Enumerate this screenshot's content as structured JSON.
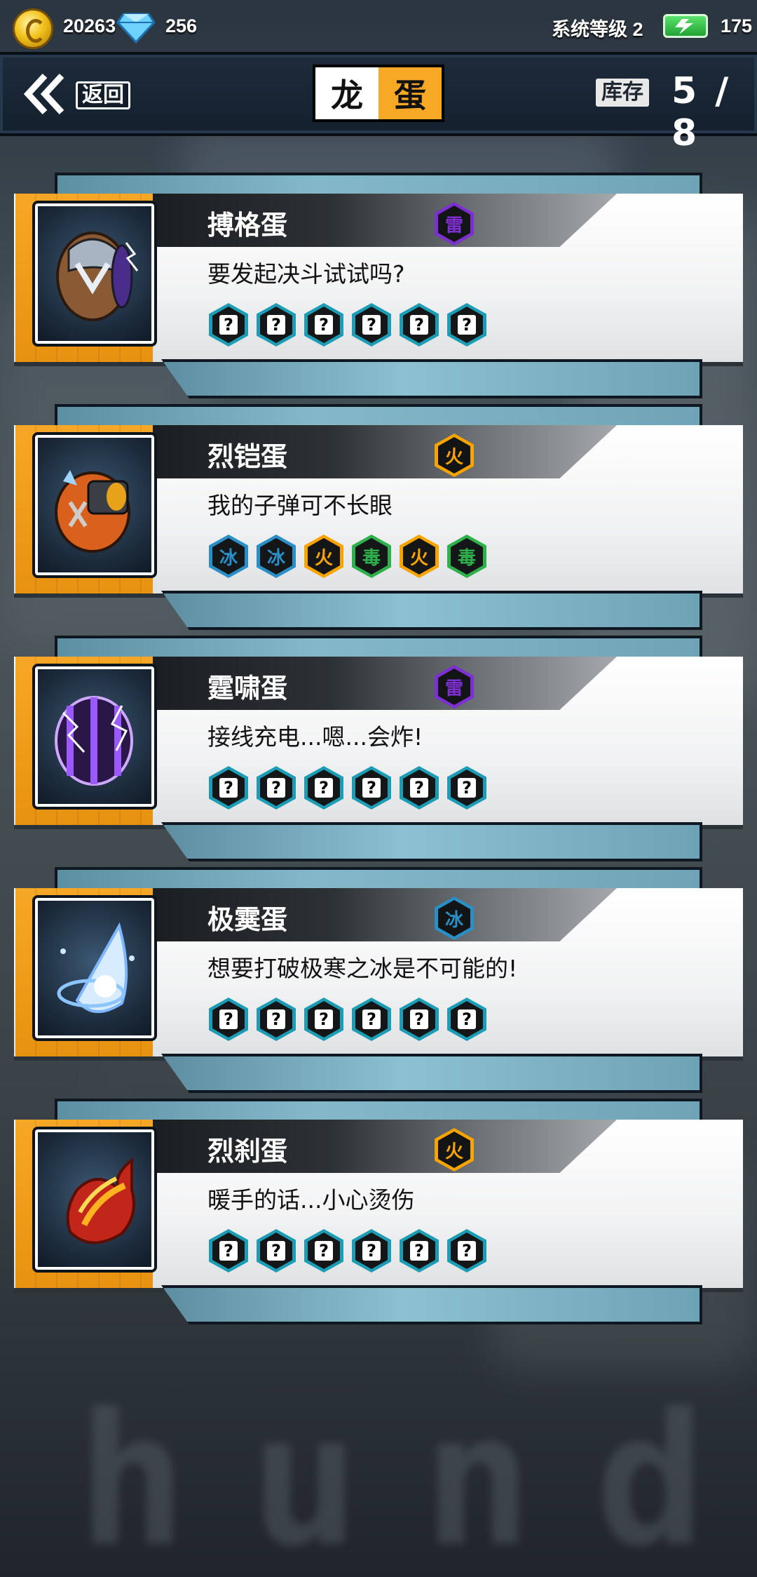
{
  "status": {
    "coins": "20263",
    "gems": "256",
    "level": "系统等级 2",
    "energy": "175"
  },
  "header": {
    "back_label": "返回",
    "title_part1": "龙",
    "title_part2": "蛋",
    "stock_label": "库存",
    "stock_value": "5 / 8"
  },
  "colors": {
    "thunder": "#7d2fd2",
    "fire": "#f7a400",
    "ice": "#2a8fc7",
    "poison": "#2eb04a",
    "unknown": "#1c9db5"
  },
  "eggs": [
    {
      "name": "搏格蛋",
      "element": "雷",
      "element_type": "thunder",
      "quote": "要发起决斗试试吗?",
      "slots": [
        {
          "label": "?",
          "type": "unknown"
        },
        {
          "label": "?",
          "type": "unknown"
        },
        {
          "label": "?",
          "type": "unknown"
        },
        {
          "label": "?",
          "type": "unknown"
        },
        {
          "label": "?",
          "type": "unknown"
        },
        {
          "label": "?",
          "type": "unknown"
        }
      ],
      "icon": "armored-egg-icon"
    },
    {
      "name": "烈铠蛋",
      "element": "火",
      "element_type": "fire",
      "quote": "我的子弹可不长眼",
      "slots": [
        {
          "label": "冰",
          "type": "ice"
        },
        {
          "label": "冰",
          "type": "ice"
        },
        {
          "label": "火",
          "type": "fire"
        },
        {
          "label": "毒",
          "type": "poison"
        },
        {
          "label": "火",
          "type": "fire"
        },
        {
          "label": "毒",
          "type": "poison"
        }
      ],
      "icon": "gun-egg-icon"
    },
    {
      "name": "霆啸蛋",
      "element": "雷",
      "element_type": "thunder",
      "quote": "接线充电...嗯...会炸!",
      "slots": [
        {
          "label": "?",
          "type": "unknown"
        },
        {
          "label": "?",
          "type": "unknown"
        },
        {
          "label": "?",
          "type": "unknown"
        },
        {
          "label": "?",
          "type": "unknown"
        },
        {
          "label": "?",
          "type": "unknown"
        },
        {
          "label": "?",
          "type": "unknown"
        }
      ],
      "icon": "lightning-egg-icon"
    },
    {
      "name": "极霙蛋",
      "element": "冰",
      "element_type": "ice",
      "quote": "想要打破极寒之冰是不可能的!",
      "slots": [
        {
          "label": "?",
          "type": "unknown"
        },
        {
          "label": "?",
          "type": "unknown"
        },
        {
          "label": "?",
          "type": "unknown"
        },
        {
          "label": "?",
          "type": "unknown"
        },
        {
          "label": "?",
          "type": "unknown"
        },
        {
          "label": "?",
          "type": "unknown"
        }
      ],
      "icon": "ice-egg-icon"
    },
    {
      "name": "烈刹蛋",
      "element": "火",
      "element_type": "fire",
      "quote": "暖手的话...小心烫伤",
      "slots": [
        {
          "label": "?",
          "type": "unknown"
        },
        {
          "label": "?",
          "type": "unknown"
        },
        {
          "label": "?",
          "type": "unknown"
        },
        {
          "label": "?",
          "type": "unknown"
        },
        {
          "label": "?",
          "type": "unknown"
        },
        {
          "label": "?",
          "type": "unknown"
        }
      ],
      "icon": "flame-egg-icon"
    }
  ]
}
